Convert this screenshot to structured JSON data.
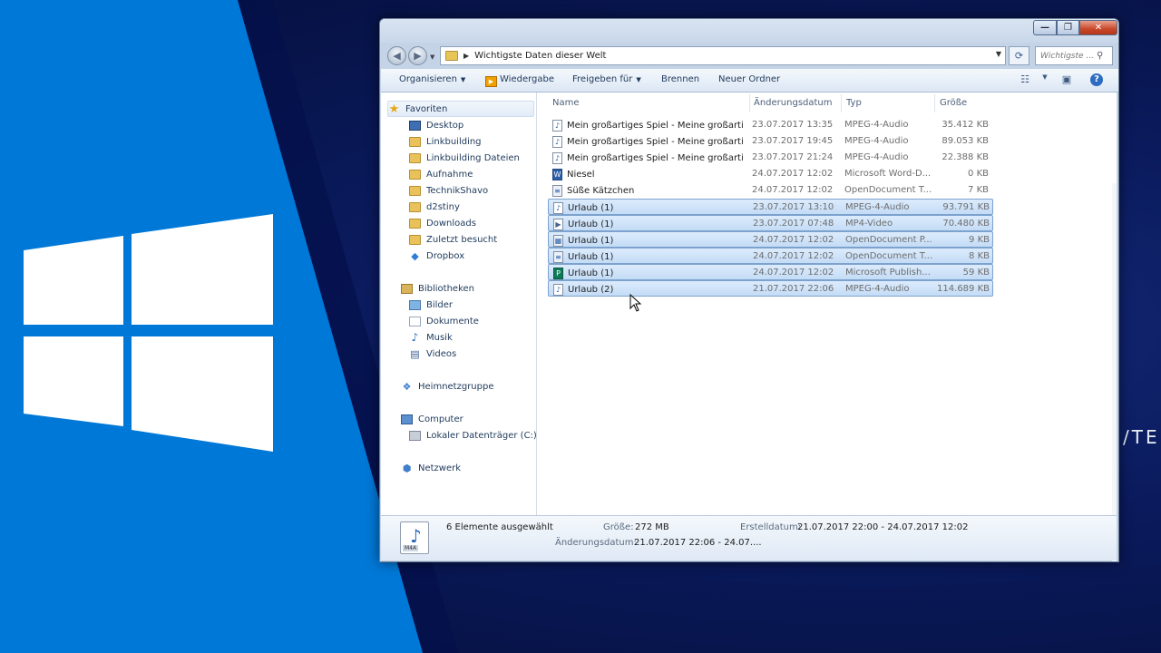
{
  "desktop": {
    "side_text": "/TE"
  },
  "window": {
    "controls": {
      "minimize": "—",
      "maximize": "❐",
      "close": "✕"
    },
    "address": {
      "path": "Wichtigste Daten dieser Welt"
    },
    "search": {
      "placeholder": "Wichtigste ..."
    }
  },
  "toolbar": {
    "organize": "Organisieren",
    "play": "Wiedergabe",
    "share": "Freigeben für",
    "burn": "Brennen",
    "new_folder": "Neuer Ordner"
  },
  "nav": {
    "favorites": "Favoriten",
    "fav_items": [
      "Desktop",
      "Linkbuilding",
      "Linkbuilding Dateien",
      "Aufnahme",
      "TechnikShavo",
      "d2stiny",
      "Downloads",
      "Zuletzt besucht",
      "Dropbox"
    ],
    "libraries": "Bibliotheken",
    "lib_items": [
      "Bilder",
      "Dokumente",
      "Musik",
      "Videos"
    ],
    "homegroup": "Heimnetzgruppe",
    "computer": "Computer",
    "drive": "Lokaler Datenträger (C:)",
    "network": "Netzwerk"
  },
  "file_list": {
    "columns": [
      "Name",
      "Änderungsdatum",
      "Typ",
      "Größe"
    ],
    "rows": [
      {
        "name": "Mein großartiges Spiel - Meine großartig...",
        "date": "23.07.2017 13:35",
        "type": "MPEG-4-Audio",
        "size": "35.412 KB",
        "icon": "music-file-icon",
        "selected": false
      },
      {
        "name": "Mein großartiges Spiel - Meine großartig...",
        "date": "23.07.2017 19:45",
        "type": "MPEG-4-Audio",
        "size": "89.053 KB",
        "icon": "music-file-icon",
        "selected": false
      },
      {
        "name": "Mein großartiges Spiel - Meine großartig...",
        "date": "23.07.2017 21:24",
        "type": "MPEG-4-Audio",
        "size": "22.388 KB",
        "icon": "music-file-icon",
        "selected": false
      },
      {
        "name": "Niesel",
        "date": "24.07.2017 12:02",
        "type": "Microsoft Word-D...",
        "size": "0 KB",
        "icon": "word-file-icon",
        "selected": false
      },
      {
        "name": "Süße Kätzchen",
        "date": "24.07.2017 12:02",
        "type": "OpenDocument T...",
        "size": "7 KB",
        "icon": "document-file-icon",
        "selected": false
      },
      {
        "name": "Urlaub (1)",
        "date": "23.07.2017 13:10",
        "type": "MPEG-4-Audio",
        "size": "93.791 KB",
        "icon": "music-file-icon",
        "selected": true
      },
      {
        "name": "Urlaub (1)",
        "date": "23.07.2017 07:48",
        "type": "MP4-Video",
        "size": "70.480 KB",
        "icon": "video-file-icon",
        "selected": true
      },
      {
        "name": "Urlaub (1)",
        "date": "24.07.2017 12:02",
        "type": "OpenDocument P...",
        "size": "9 KB",
        "icon": "presentation-file-icon",
        "selected": true
      },
      {
        "name": "Urlaub (1)",
        "date": "24.07.2017 12:02",
        "type": "OpenDocument T...",
        "size": "8 KB",
        "icon": "document-file-icon",
        "selected": true
      },
      {
        "name": "Urlaub (1)",
        "date": "24.07.2017 12:02",
        "type": "Microsoft Publish...",
        "size": "59 KB",
        "icon": "publisher-file-icon",
        "selected": true
      },
      {
        "name": "Urlaub (2)",
        "date": "21.07.2017 22:06",
        "type": "MPEG-4-Audio",
        "size": "114.689 KB",
        "icon": "music-file-icon",
        "selected": true
      }
    ]
  },
  "details": {
    "file_tag": "M4A",
    "count": "6 Elemente ausgewählt",
    "size_label": "Größe:",
    "size_value": "272 MB",
    "created_label": "Erstelldatum:",
    "created_value": "21.07.2017 22:00 - 24.07.2017 12:02",
    "modified_label": "Änderungsdatum:",
    "modified_value": "21.07.2017 22:06 - 24.07...."
  },
  "colors": {
    "desktop_blue": "#0078d7",
    "background_navy": "#0a1a5c",
    "selection": "#c4dcf6"
  }
}
